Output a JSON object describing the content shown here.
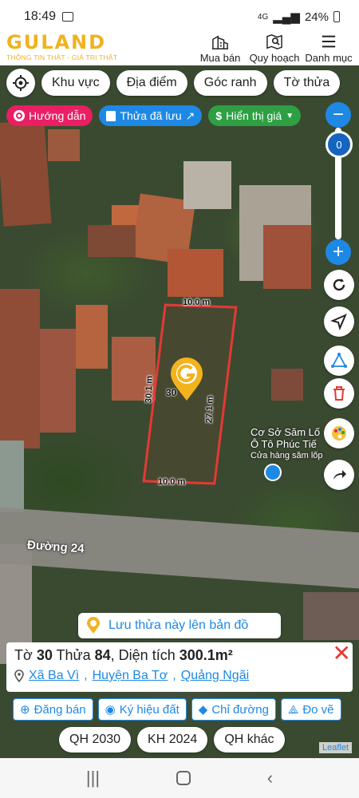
{
  "status": {
    "time": "18:49",
    "battery": "24%",
    "network": "4G"
  },
  "header": {
    "logo": "GULAND",
    "tagline": "THÔNG TIN THẬT - GIÁ TRỊ THẬT",
    "nav": [
      {
        "label": "Mua bán",
        "icon": "buildings-icon"
      },
      {
        "label": "Quy hoạch",
        "icon": "map-search-icon"
      },
      {
        "label": "Danh mục",
        "icon": "menu-icon"
      }
    ]
  },
  "filters": {
    "row1": [
      "Khu vực",
      "Địa điểm",
      "Góc ranh",
      "Tờ thửa"
    ],
    "guide": "Hướng dẫn",
    "saved": "Thửa đã lưu",
    "price": "Hiển thị giá"
  },
  "zoom": {
    "level": "0",
    "minus": "−",
    "plus": "+"
  },
  "map": {
    "dim_top": "10.0 m",
    "dim_bottom": "10.0 m",
    "dim_left": "30.1 m",
    "dim_right": "27.1 m",
    "area_partial": "30",
    "road": "Đường 24",
    "poi_line1": "Cơ Sở Săm Lố",
    "poi_line2": "Ô Tô Phúc Tiế",
    "poi_line3": "Cửa hàng săm lốp"
  },
  "save_banner": "Lưu thửa này lên bản đồ",
  "parcel_info": {
    "sheet_label": "Tờ",
    "sheet": "30",
    "plot_label": "Thửa",
    "plot": "84",
    "area_label": ", Diện tích",
    "area": "300.1m²",
    "commune": "Xã Ba Vì",
    "district": "Huyện Ba Tơ",
    "province": "Quảng Ngãi"
  },
  "actions": [
    "Đăng bán",
    "Ký hiệu đất",
    "Chỉ đường",
    "Đo vẽ"
  ],
  "plans": [
    "QH 2030",
    "KH 2024",
    "QH khác"
  ],
  "attribution": "Leaflet",
  "colors": {
    "accent": "#1e88e5",
    "brand": "#f0b21f",
    "parcel": "#e53935"
  }
}
